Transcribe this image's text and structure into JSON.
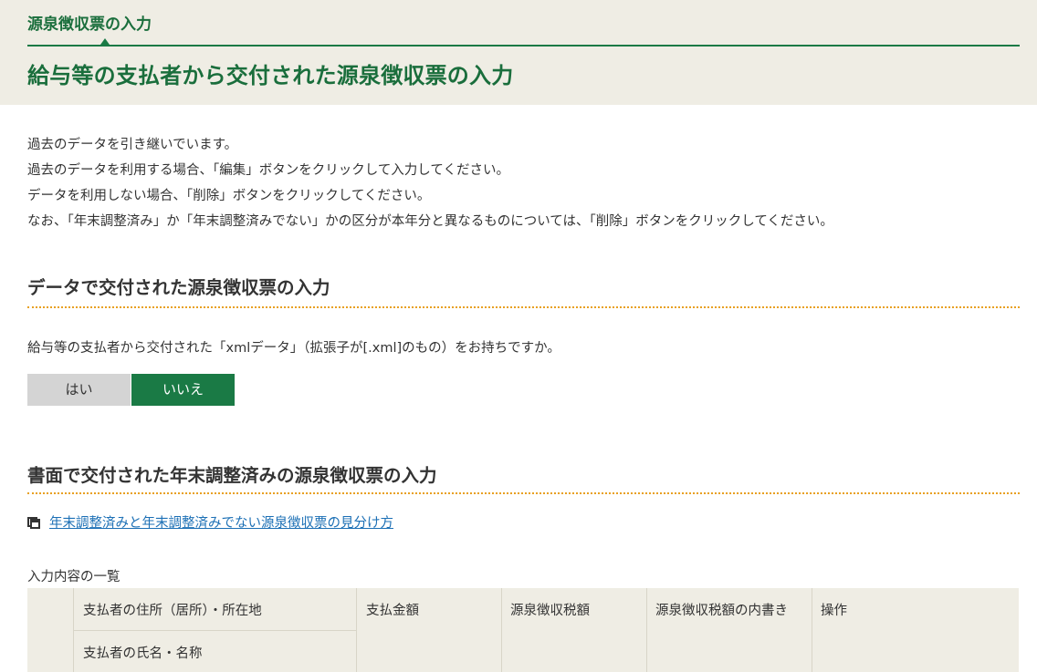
{
  "header": {
    "breadcrumb": "源泉徴収票の入力",
    "title": "給与等の支払者から交付された源泉徴収票の入力"
  },
  "intro": {
    "lines": [
      "過去のデータを引き継いでいます。",
      "過去のデータを利用する場合、「編集」ボタンをクリックして入力してください。",
      "データを利用しない場合、「削除」ボタンをクリックしてください。",
      "なお、「年末調整済み」か「年末調整済みでない」かの区分が本年分と異なるものについては、「削除」ボタンをクリックしてください。"
    ]
  },
  "data_section": {
    "heading": "データで交付された源泉徴収票の入力",
    "question": "給与等の支払者から交付された「xmlデータ」（拡張子が[.xml]のもの）をお持ちですか。",
    "yes_label": "はい",
    "no_label": "いいえ",
    "selected": "いいえ"
  },
  "paper_section": {
    "heading": "書面で交付された年末調整済みの源泉徴収票の入力",
    "help_link": "年末調整済みと年末調整済みでない源泉徴収票の見分け方",
    "list_caption": "入力内容の一覧"
  },
  "table": {
    "col_address": "支払者の住所（居所）・所在地",
    "col_name": "支払者の氏名・名称",
    "col_amount": "支払金額",
    "col_tax": "源泉徴収税額",
    "col_tax_breakdown": "源泉徴収税額の内書き",
    "col_action": "操作"
  },
  "colors": {
    "brand_green": "#1a7a45",
    "header_bg": "#efede4",
    "accent_orange": "#e8a020",
    "link_blue": "#1b6fb5"
  }
}
